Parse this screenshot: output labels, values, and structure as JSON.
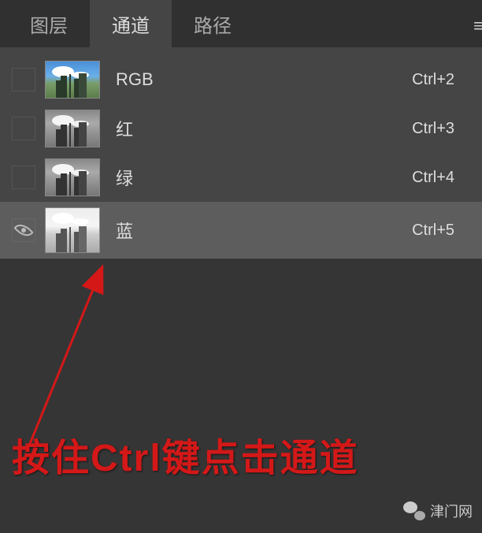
{
  "tabs": {
    "layers": "图层",
    "channels": "通道",
    "paths": "路径"
  },
  "channels": [
    {
      "name": "RGB",
      "shortcut": "Ctrl+2",
      "visible": false,
      "selected": false,
      "thumb": "rgb"
    },
    {
      "name": "红",
      "shortcut": "Ctrl+3",
      "visible": false,
      "selected": false,
      "thumb": "gray"
    },
    {
      "name": "绿",
      "shortcut": "Ctrl+4",
      "visible": false,
      "selected": false,
      "thumb": "gray"
    },
    {
      "name": "蓝",
      "shortcut": "Ctrl+5",
      "visible": true,
      "selected": true,
      "thumb": "blue"
    }
  ],
  "annotation": "按住Ctrl键点击通道",
  "watermark": "津门网"
}
